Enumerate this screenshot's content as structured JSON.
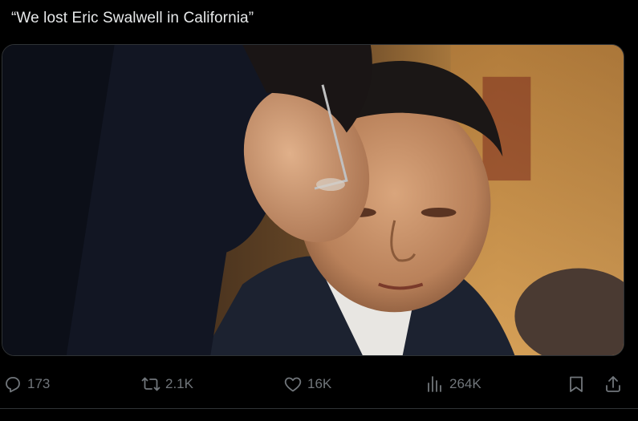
{
  "tweet": {
    "text": "“We lost Eric Swalwell in California”"
  },
  "media": {
    "kind": "photo",
    "description_icon": "photo-image"
  },
  "actions": {
    "reply": {
      "icon": "reply-icon",
      "count": "173"
    },
    "retweet": {
      "icon": "retweet-icon",
      "count": "2.1K"
    },
    "like": {
      "icon": "heart-icon",
      "count": "16K"
    },
    "views": {
      "icon": "views-bar-chart-icon",
      "count": "264K"
    },
    "bookmark": {
      "icon": "bookmark-icon"
    },
    "share": {
      "icon": "share-icon"
    }
  },
  "colors": {
    "background": "#000000",
    "text": "#e7e9ea",
    "muted": "#71767b",
    "border": "#2f3336"
  }
}
